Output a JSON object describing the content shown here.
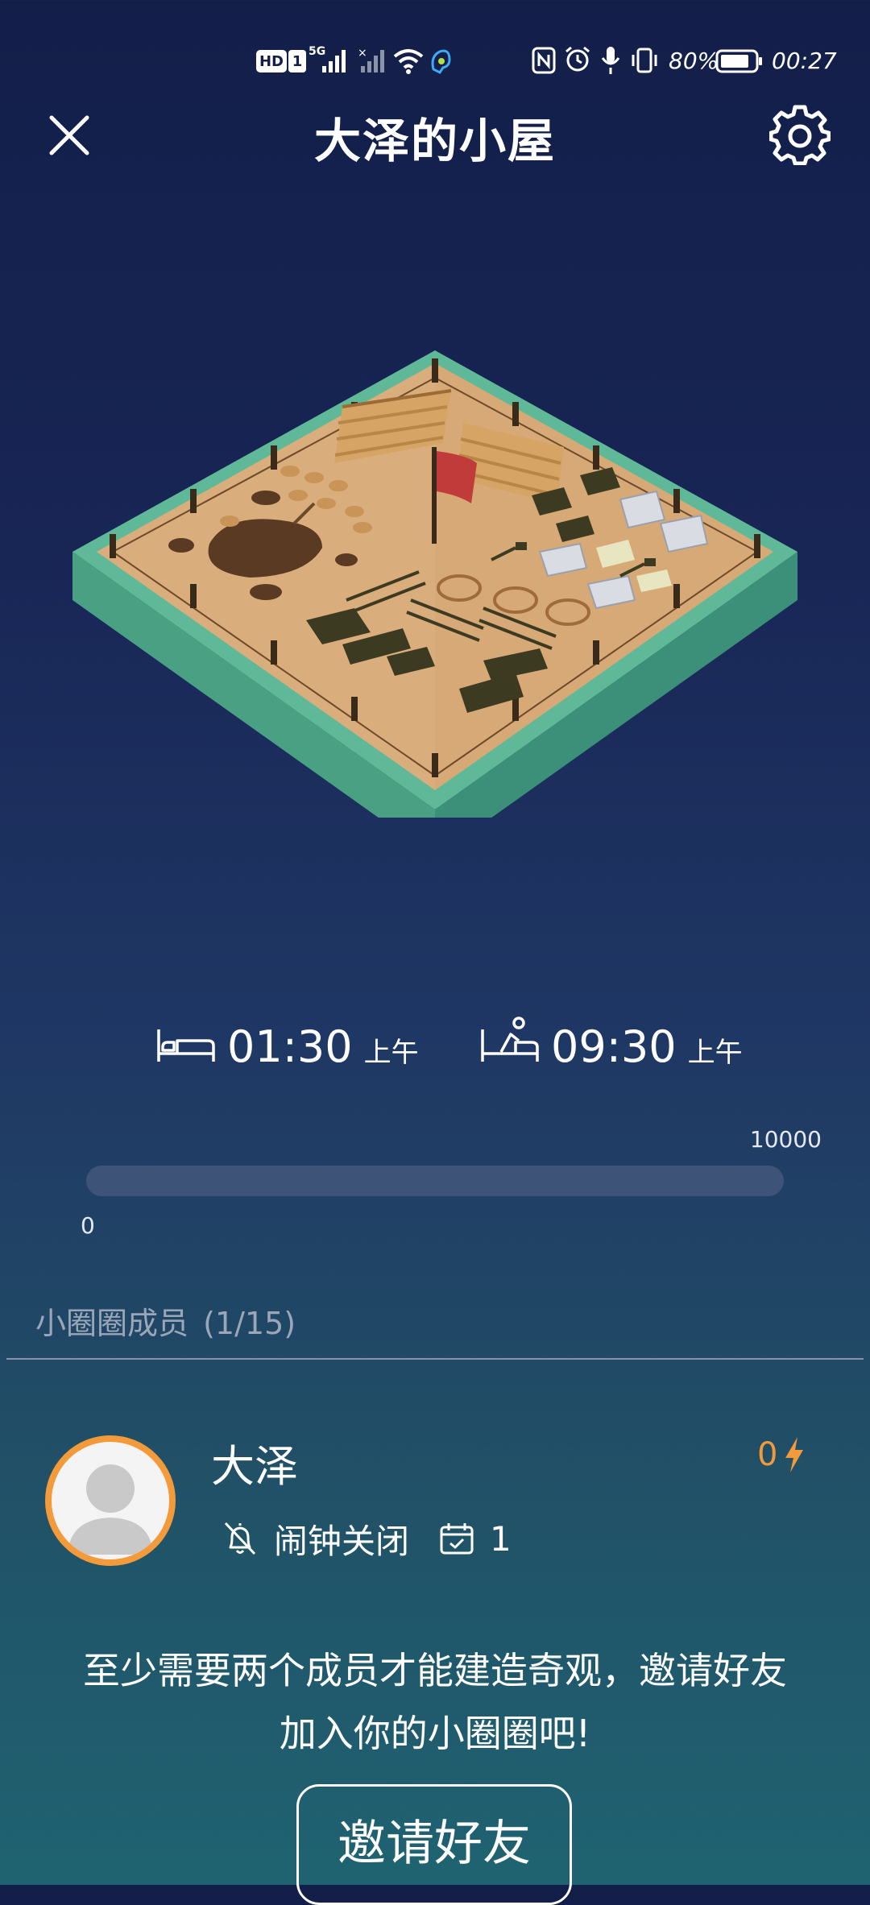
{
  "status_bar": {
    "hd": "HD",
    "sim": "1",
    "network": "5G",
    "battery": "80%",
    "time": "00:27"
  },
  "header": {
    "title": "大泽的小屋",
    "close_icon": "close-icon",
    "settings_icon": "gear-icon"
  },
  "scene": {
    "description_icon": "construction-site-illustration"
  },
  "sleep": {
    "bedtime": {
      "icon": "bed-icon",
      "time": "01:30",
      "ampm": "上午"
    },
    "wake": {
      "icon": "wake-up-bed-icon",
      "time": "09:30",
      "ampm": "上午"
    }
  },
  "progress": {
    "max_label": "10000",
    "min_label": "0",
    "value_fraction": 0
  },
  "members": {
    "label": "小圈圈成员",
    "count": "(1/15)",
    "list": [
      {
        "name": "大泽",
        "energy": "0",
        "alarm_status": "闹钟关闭",
        "checkin_count": "1"
      }
    ]
  },
  "hint": {
    "line1": "至少需要两个成员才能建造奇观，邀请好友",
    "line2": "加入你的小圈圈吧!"
  },
  "invite_button": "邀请好友",
  "colors": {
    "accent": "#f39a3a",
    "track": "#3d5478"
  }
}
